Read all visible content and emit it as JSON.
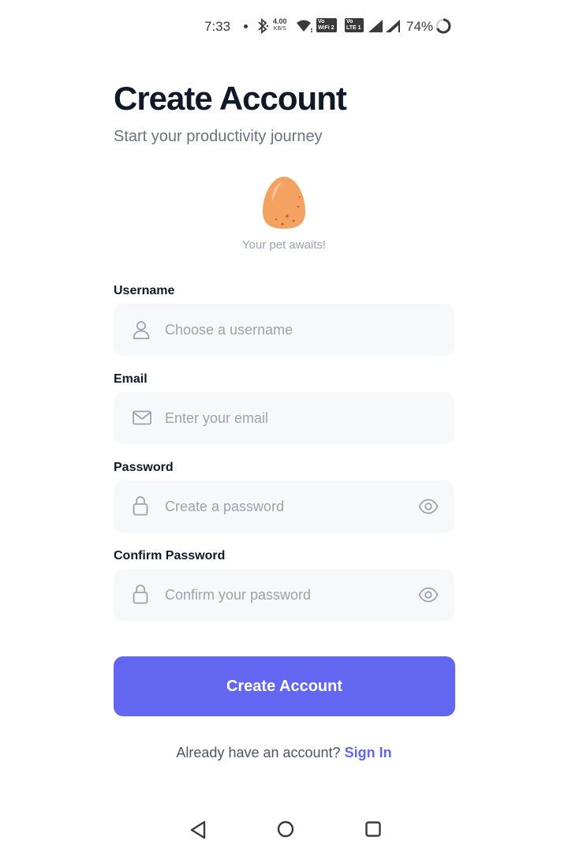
{
  "status_bar": {
    "time": "7:33",
    "net_speed_value": "4.00",
    "net_speed_unit": "KB/S",
    "volte1_top": "Vo",
    "volte1_bottom": "WiFi 2",
    "volte2_top": "Vo",
    "volte2_bottom": "LTE 1",
    "battery": "74%"
  },
  "header": {
    "title": "Create Account",
    "subtitle": "Start your productivity journey"
  },
  "pet": {
    "caption": "Your pet awaits!",
    "egg_color": "#f4a261"
  },
  "form": {
    "username": {
      "label": "Username",
      "placeholder": "Choose a username",
      "value": ""
    },
    "email": {
      "label": "Email",
      "placeholder": "Enter your email",
      "value": ""
    },
    "password": {
      "label": "Password",
      "placeholder": "Create a password",
      "value": ""
    },
    "confirm_password": {
      "label": "Confirm Password",
      "placeholder": "Confirm your password",
      "value": ""
    },
    "submit_label": "Create Account"
  },
  "footer": {
    "prompt": "Already have an account?",
    "signin_label": "Sign In"
  },
  "colors": {
    "accent": "#6366f1",
    "field_bg": "#f7f8fa",
    "placeholder": "#9ca3af"
  },
  "icons": [
    "user-icon",
    "mail-icon",
    "lock-icon",
    "eye-icon",
    "back-icon",
    "home-icon",
    "recents-icon"
  ]
}
